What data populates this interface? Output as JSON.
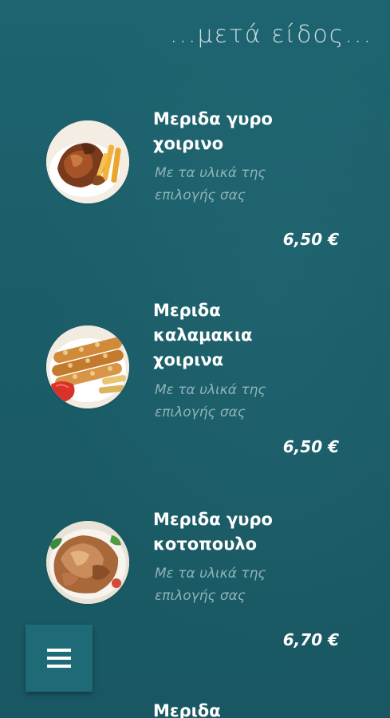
{
  "header": {
    "title": "...μετά είδος..."
  },
  "items": [
    {
      "name_line1": "Μεριδα γυρο",
      "name_line2": "χοιρινο",
      "name_line3": "",
      "desc_line1": "Με τα υλικά της",
      "desc_line2": "επιλογής σας",
      "price": "6,50 €",
      "image_icon": "pork-gyro-plate-icon"
    },
    {
      "name_line1": "Μεριδα",
      "name_line2": "καλαμακια",
      "name_line3": "χοιρινα",
      "desc_line1": "Με τα υλικά της",
      "desc_line2": "επιλογής σας",
      "price": "6,50 €",
      "image_icon": "pork-skewers-plate-icon"
    },
    {
      "name_line1": "Μεριδα γυρο",
      "name_line2": "κοτοπουλο",
      "name_line3": "",
      "desc_line1": "Με τα υλικά της",
      "desc_line2": "επιλογής σας",
      "price": "6,70 €",
      "image_icon": "chicken-gyro-plate-icon"
    },
    {
      "name_line1": "Μεριδα"
    }
  ],
  "fab": {
    "icon": "hamburger-menu-icon"
  }
}
